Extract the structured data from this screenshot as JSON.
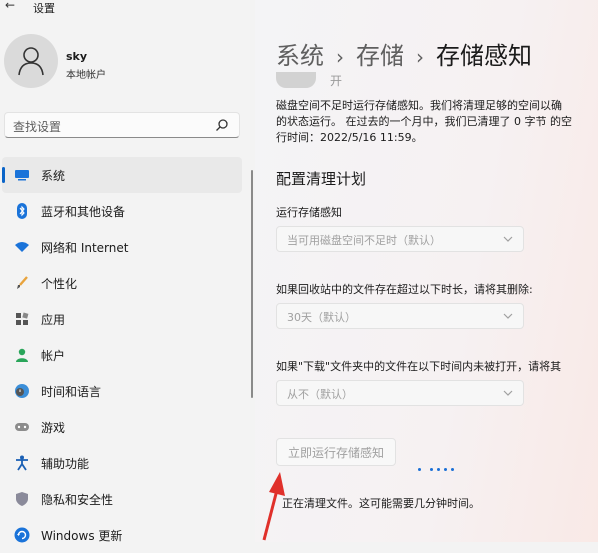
{
  "window": {
    "back_glyph": "←",
    "title": "设置"
  },
  "user": {
    "name": "sky",
    "account_type": "本地帐户"
  },
  "search": {
    "placeholder": "查找设置"
  },
  "nav": {
    "items": [
      {
        "label": "系统",
        "icon": "system-icon",
        "active": true
      },
      {
        "label": "蓝牙和其他设备",
        "icon": "bluetooth-icon"
      },
      {
        "label": "网络和 Internet",
        "icon": "wifi-icon"
      },
      {
        "label": "个性化",
        "icon": "brush-icon"
      },
      {
        "label": "应用",
        "icon": "apps-icon"
      },
      {
        "label": "帐户",
        "icon": "account-icon"
      },
      {
        "label": "时间和语言",
        "icon": "globe-clock-icon"
      },
      {
        "label": "游戏",
        "icon": "gamepad-icon"
      },
      {
        "label": "辅助功能",
        "icon": "accessibility-icon"
      },
      {
        "label": "隐私和安全性",
        "icon": "shield-icon"
      },
      {
        "label": "Windows 更新",
        "icon": "update-icon"
      }
    ]
  },
  "breadcrumb": {
    "part1": "系统",
    "sep1": "›",
    "part2": "存储",
    "sep2": "›",
    "current": "存储感知"
  },
  "toggle_state": "开",
  "description": {
    "line1": "磁盘空间不足时运行存储感知。我们将清理足够的空间以确",
    "line2": "的状态运行。 在过去的一个月中，我们已清理了 0 字节 的空",
    "line3": "行时间：2022/5/16 11:59。"
  },
  "schedule": {
    "title": "配置清理计划",
    "run_label": "运行存储感知",
    "run_value": "当可用磁盘空间不足时（默认）",
    "recycle_label": "如果回收站中的文件存在超过以下时长，请将其删除:",
    "recycle_value": "30天（默认）",
    "downloads_label": "如果\"下载\"文件夹中的文件在以下时间内未被打开，请将其",
    "downloads_value": "从不（默认）"
  },
  "run_now_button": "立即运行存储感知",
  "status_text": "正在清理文件。这可能需要几分钟时间。",
  "colors": {
    "accent": "#0a64c8",
    "annotation_arrow": "#e0302a"
  }
}
